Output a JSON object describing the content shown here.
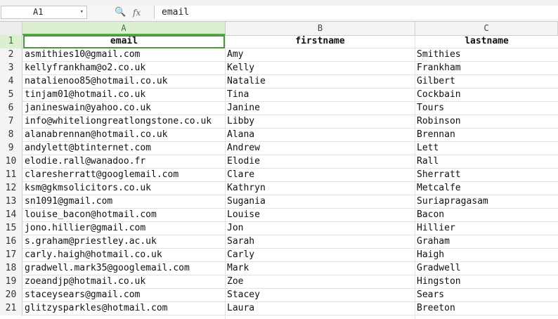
{
  "formula_bar": {
    "name_box": "A1",
    "name_box_arrow": "▾",
    "zoom_icon": "🔍",
    "fx_label": "fx",
    "content": "email"
  },
  "columns": [
    "A",
    "B",
    "C"
  ],
  "header_row": {
    "num": "1",
    "email": "email",
    "firstname": "firstname",
    "lastname": "lastname"
  },
  "rows": [
    {
      "num": "2",
      "email": "asmithies10@gmail.com",
      "firstname": "Amy",
      "lastname": "Smithies"
    },
    {
      "num": "3",
      "email": "kellyfrankham@o2.co.uk",
      "firstname": "Kelly",
      "lastname": "Frankham"
    },
    {
      "num": "4",
      "email": "natalienoo85@hotmail.co.uk",
      "firstname": "Natalie",
      "lastname": "Gilbert"
    },
    {
      "num": "5",
      "email": "tinjam01@hotmail.co.uk",
      "firstname": "Tina",
      "lastname": "Cockbain"
    },
    {
      "num": "6",
      "email": "janineswain@yahoo.co.uk",
      "firstname": "Janine",
      "lastname": "Tours"
    },
    {
      "num": "7",
      "email": "info@whiteliongreatlongstone.co.uk",
      "firstname": "Libby",
      "lastname": "Robinson"
    },
    {
      "num": "8",
      "email": "alanabrennan@hotmail.co.uk",
      "firstname": "Alana",
      "lastname": "Brennan"
    },
    {
      "num": "9",
      "email": "andylett@btinternet.com",
      "firstname": "Andrew",
      "lastname": "Lett"
    },
    {
      "num": "10",
      "email": "elodie.rall@wanadoo.fr",
      "firstname": "Elodie",
      "lastname": "Rall"
    },
    {
      "num": "11",
      "email": "claresherratt@googlemail.com",
      "firstname": "Clare",
      "lastname": "Sherratt"
    },
    {
      "num": "12",
      "email": "ksm@gkmsolicitors.co.uk",
      "firstname": "Kathryn",
      "lastname": "Metcalfe"
    },
    {
      "num": "13",
      "email": "sn1091@gmail.com",
      "firstname": "Sugania",
      "lastname": "Suriapragasam"
    },
    {
      "num": "14",
      "email": "louise_bacon@hotmail.com",
      "firstname": "Louise",
      "lastname": "Bacon"
    },
    {
      "num": "15",
      "email": "jono.hillier@gmail.com",
      "firstname": "Jon",
      "lastname": "Hillier"
    },
    {
      "num": "16",
      "email": "s.graham@priestley.ac.uk",
      "firstname": "Sarah",
      "lastname": "Graham"
    },
    {
      "num": "17",
      "email": "carly.haigh@hotmail.co.uk",
      "firstname": "Carly",
      "lastname": "Haigh"
    },
    {
      "num": "18",
      "email": "gradwell.mark35@googlemail.com",
      "firstname": "Mark",
      "lastname": "Gradwell"
    },
    {
      "num": "19",
      "email": "zoeandjp@hotmail.co.uk",
      "firstname": "Zoe",
      "lastname": "Hingston"
    },
    {
      "num": "20",
      "email": "staceysears@gmail.com",
      "firstname": "Stacey",
      "lastname": "Sears"
    },
    {
      "num": "21",
      "email": "glitzysparkles@hotmail.com",
      "firstname": "Laura",
      "lastname": "Breeton"
    }
  ]
}
